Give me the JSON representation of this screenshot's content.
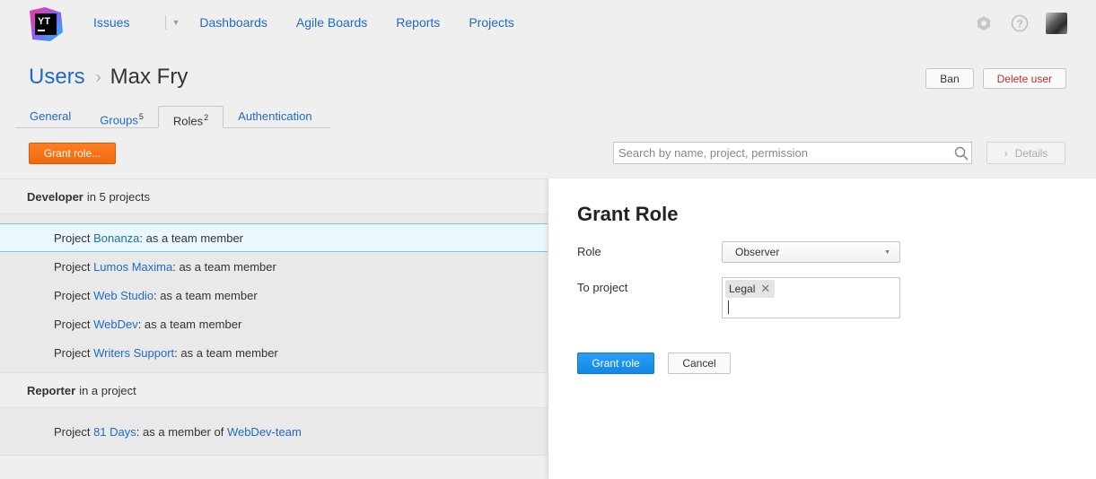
{
  "logo": {
    "text": "YT"
  },
  "nav": {
    "items": [
      "Issues",
      "Dashboards",
      "Agile Boards",
      "Reports",
      "Projects"
    ]
  },
  "header_icons": [
    "settings-icon",
    "help-icon",
    "avatar"
  ],
  "breadcrumb": {
    "parent": "Users",
    "current": "Max Fry"
  },
  "actions": {
    "ban": "Ban",
    "delete": "Delete user"
  },
  "tabs": [
    {
      "label": "General",
      "count": ""
    },
    {
      "label": "Groups",
      "count": "5"
    },
    {
      "label": "Roles",
      "count": "2"
    },
    {
      "label": "Authentication",
      "count": ""
    }
  ],
  "toolbar": {
    "grant_button": "Grant role...",
    "search_placeholder": "Search by name, project, permission",
    "details": "Details"
  },
  "roles": [
    {
      "role": "Developer",
      "scope": "in 5 projects",
      "entries": [
        {
          "prefix": "Project ",
          "project": "Bonanza",
          "suffix": ": as a team member"
        },
        {
          "prefix": "Project ",
          "project": "Lumos Maxima",
          "suffix": ": as a team member"
        },
        {
          "prefix": "Project ",
          "project": "Web Studio",
          "suffix": ": as a team member"
        },
        {
          "prefix": "Project ",
          "project": "WebDev",
          "suffix": ": as a team member"
        },
        {
          "prefix": "Project ",
          "project": "Writers Support",
          "suffix": ": as a team member"
        }
      ]
    },
    {
      "role": "Reporter",
      "scope": "in a project",
      "entries": [
        {
          "prefix": "Project ",
          "project": "81 Days",
          "suffix": ": as a member of ",
          "group": "WebDev-team"
        }
      ]
    }
  ],
  "panel": {
    "title": "Grant Role",
    "role_label": "Role",
    "role_value": "Observer",
    "project_label": "To project",
    "project_tag": "Legal",
    "submit": "Grant role",
    "cancel": "Cancel"
  },
  "colors": {
    "accent": "#1e6bc6",
    "grant_orange": "#f57316",
    "submit_blue": "#1a8fee",
    "danger": "#c0302a",
    "selected_row": "#eaf7fd"
  }
}
